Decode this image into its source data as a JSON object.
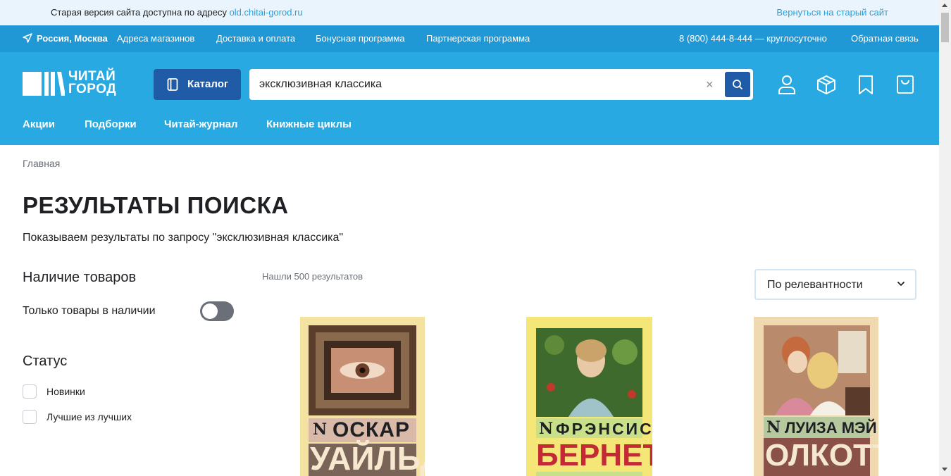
{
  "notice": {
    "text": "Старая версия сайта доступна по адресу ",
    "link": "old.chitai-gorod.ru",
    "return_link": "Вернуться на старый сайт"
  },
  "topbar": {
    "location": "Россия, Москва",
    "links": [
      "Адреса магазинов",
      "Доставка и оплата",
      "Бонусная программа",
      "Партнерская программа"
    ],
    "phone": "8 (800) 444-8-444 — круглосуточно",
    "feedback": "Обратная связь"
  },
  "header": {
    "logo_line1": "ЧИТАЙ",
    "logo_line2": "ГОРОД",
    "catalog_label": "Каталог",
    "search_value": "эксклюзивная классика",
    "clear_symbol": "×",
    "nav": [
      "Акции",
      "Подборки",
      "Читай-журнал",
      "Книжные циклы"
    ]
  },
  "breadcrumb": "Главная",
  "title": "РЕЗУЛЬТАТЫ ПОИСКА",
  "subtitle": "Показываем результаты по запросу \"эксклюзивная классика\"",
  "filters": {
    "availability_title": "Наличие товаров",
    "only_in_stock": "Только товары в наличии",
    "only_in_stock_on": false,
    "status_title": "Статус",
    "status_options": [
      {
        "label": "Новинки",
        "checked": false
      },
      {
        "label": "Лучшие из лучших",
        "checked": false
      }
    ]
  },
  "results": {
    "count_text": "Нашли 500 результатов",
    "sort_value": "По релевантности"
  },
  "books": [
    {
      "series_letter": "N",
      "first": "ОСКАР",
      "last": "УАЙЛЬД",
      "bg": "#f4e3a0",
      "band": "#d9b9a7",
      "last_color": "#f7e9d0",
      "last_bg": "#7a6357"
    },
    {
      "series_letter": "N",
      "first": "ФРЭНСИС",
      "last": "БЕРНЕТТ",
      "bg": "#f4e777",
      "band": "#c8e08a",
      "last_color": "#c42a36",
      "last_bg": "#f4e777"
    },
    {
      "series_letter": "N",
      "first": "ЛУИЗА МЭЙ",
      "last": "ОЛКОТТ",
      "bg": "#eed9b0",
      "band": "#b6c89e",
      "last_color": "#f5e8d2",
      "last_bg": "#8a5148"
    }
  ],
  "colors": {
    "accent": "#29a9e1",
    "topbar": "#2198d6",
    "button": "#1f5ba6",
    "notice_bg": "#eaf4fc"
  },
  "icons": [
    "location-arrow-icon",
    "book-icon",
    "close-icon",
    "search-icon",
    "user-icon",
    "package-icon",
    "bookmark-icon",
    "cart-icon",
    "chevron-down-icon"
  ]
}
